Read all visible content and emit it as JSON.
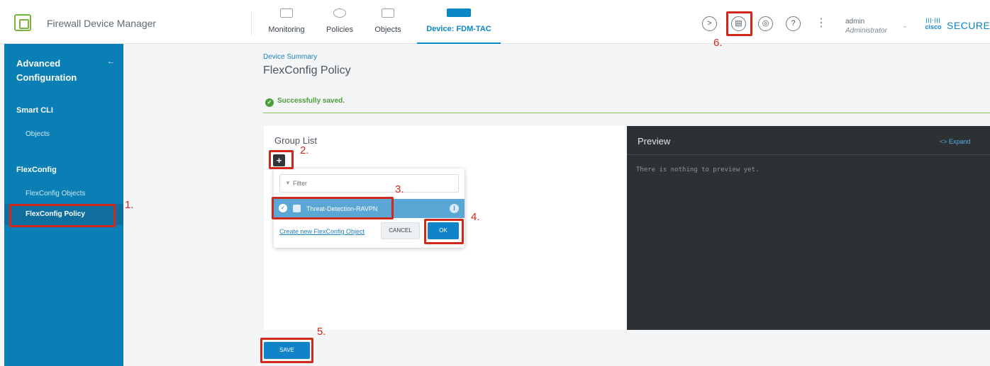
{
  "header": {
    "app_title": "Firewall Device Manager",
    "tabs": [
      {
        "label": "Monitoring",
        "icon": "monitoring-icon"
      },
      {
        "label": "Policies",
        "icon": "policies-icon"
      },
      {
        "label": "Objects",
        "icon": "objects-icon"
      },
      {
        "label": "Device: FDM-TAC",
        "icon": "device-icon",
        "active": true
      }
    ],
    "right_icons": [
      "cli-console-icon",
      "deploy-icon",
      "api-explorer-icon",
      "help-icon",
      "more-options-icon"
    ],
    "user": {
      "name": "admin",
      "role": "Administrator"
    },
    "brand": {
      "cisco": "cisco",
      "secure": "SECURE"
    }
  },
  "sidebar": {
    "title": "Advanced Configuration",
    "back_icon": "←",
    "sections": [
      {
        "label": "Smart CLI",
        "items": [
          "Objects"
        ]
      },
      {
        "label": "FlexConfig",
        "items": [
          "FlexConfig Objects",
          "FlexConfig Policy"
        ]
      }
    ],
    "active_item": "FlexConfig Policy"
  },
  "main": {
    "breadcrumb": "Device Summary",
    "title": "FlexConfig Policy",
    "success_message": "Successfully saved.",
    "group_list": {
      "title": "Group List",
      "add_symbol": "+",
      "filter_placeholder": "Filter",
      "option": "Threat-Detection-RAVPN",
      "create_link": "Create new FlexConfig Object",
      "cancel_label": "CANCEL",
      "ok_label": "OK"
    },
    "preview": {
      "title": "Preview",
      "expand_label": "<> Expand",
      "empty_text": "There is nothing to preview yet."
    },
    "save_label": "SAVE"
  },
  "annotations": [
    "1.",
    "2.",
    "3.",
    "4.",
    "5.",
    "6."
  ],
  "colors": {
    "sidebar": "#0a7fb5",
    "accent": "#0a86c7",
    "success": "#4a9e3a",
    "annotation": "#d0281b",
    "preview_bg": "#2e3133"
  }
}
